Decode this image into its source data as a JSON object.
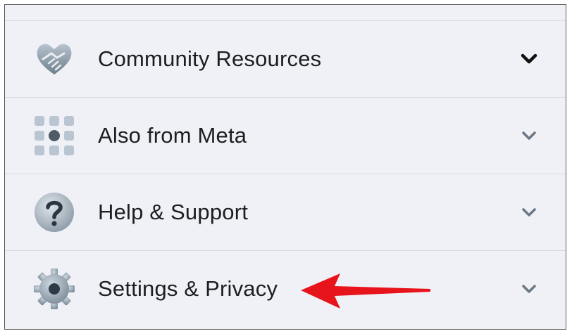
{
  "menu": {
    "items": [
      {
        "label": "Community Resources",
        "icon": "handshake-heart-icon",
        "chevron": "chevron-down-icon",
        "expanded_emphasis": true
      },
      {
        "label": "Also from Meta",
        "icon": "grid-apps-icon",
        "chevron": "chevron-down-icon",
        "expanded_emphasis": false
      },
      {
        "label": "Help & Support",
        "icon": "question-circle-icon",
        "chevron": "chevron-down-icon",
        "expanded_emphasis": false
      },
      {
        "label": "Settings & Privacy",
        "icon": "gear-icon",
        "chevron": "chevron-down-icon",
        "expanded_emphasis": false
      }
    ]
  },
  "annotation": {
    "type": "red-arrow",
    "color": "#e8141c",
    "points_to": "Settings & Privacy"
  },
  "colors": {
    "background": "#f0f1f6",
    "divider": "#d8d9de",
    "text": "#1c1e21",
    "icon_gray": "#8a96a3"
  }
}
